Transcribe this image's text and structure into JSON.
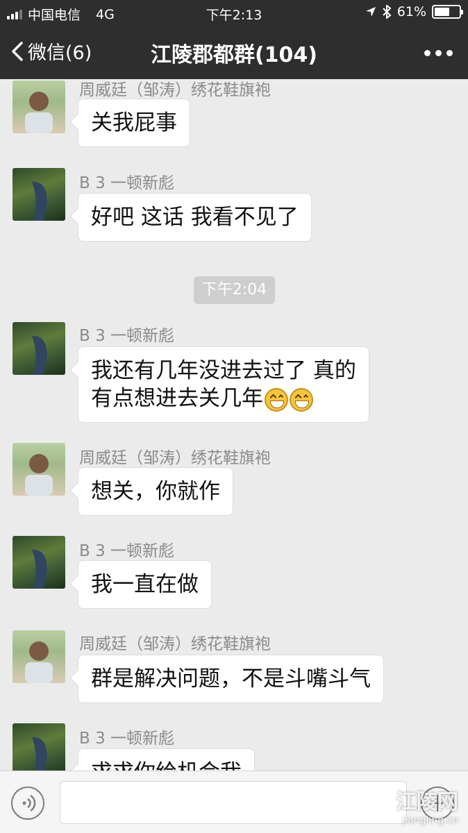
{
  "status_bar": {
    "carrier": "中国电信",
    "network": "4G",
    "time": "下午2:13",
    "battery": "61%",
    "battery_level": 0.61
  },
  "navbar": {
    "back_label": "微信(6)",
    "title": "江陵郡都群(104)"
  },
  "messages": [
    {
      "sender": "周威廷（邹涛）绣花鞋旗袍",
      "lines": [
        "关我屁事"
      ]
    },
    {
      "sender": "B 3 一顿新彪",
      "lines": [
        "好吧 这话 我看不见了"
      ]
    },
    {
      "time": "下午2:04"
    },
    {
      "sender": "B 3 一顿新彪",
      "lines": [
        "我还有几年没进去过了 真的",
        "有点想进去关几年"
      ],
      "emoji": [
        "grin-emoji",
        "grin-emoji"
      ]
    },
    {
      "sender": "周威廷（邹涛）绣花鞋旗袍",
      "lines": [
        "想关，你就作"
      ]
    },
    {
      "sender": "B 3 一顿新彪",
      "lines": [
        "我一直在做"
      ]
    },
    {
      "sender": "周威廷（邹涛）绣花鞋旗袍",
      "lines": [
        "群是解决问题，不是斗嘴斗气"
      ]
    },
    {
      "sender": "B 3 一顿新彪",
      "lines": [
        "求求你给机会我"
      ]
    }
  ],
  "watermark": {
    "name": "江陵网",
    "url": "jiangling.cn"
  },
  "icons": {
    "voice": "voice-icon",
    "plus": "plus-icon",
    "more": "more-icon",
    "back": "chevron-left-icon"
  }
}
